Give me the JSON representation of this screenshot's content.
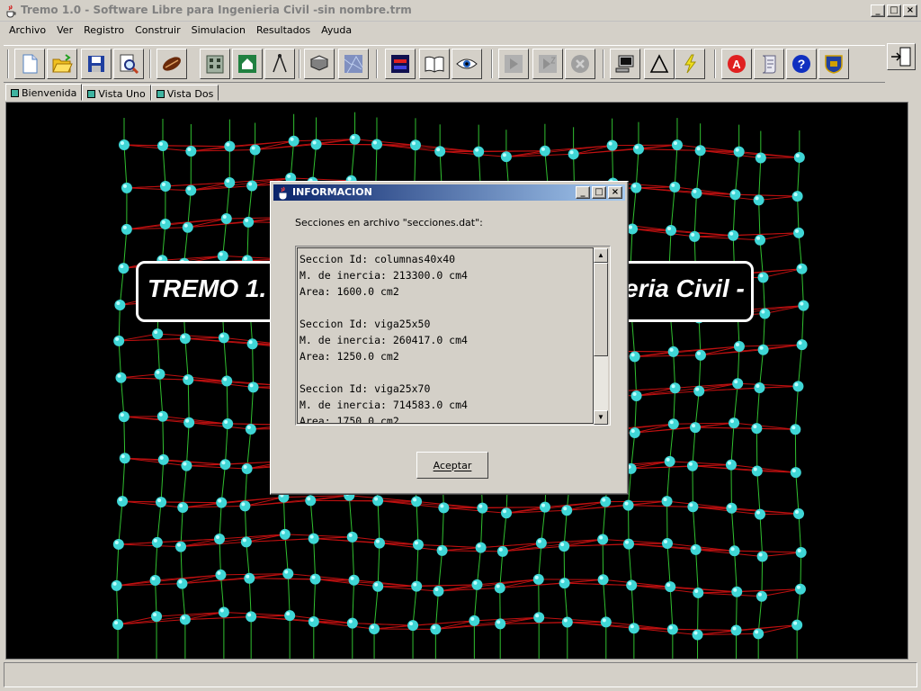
{
  "window": {
    "title": "Tremo 1.0 - Software Libre para Ingenieria Civil -sin nombre.trm",
    "controls": [
      "_",
      "□",
      "×"
    ]
  },
  "menu": [
    "Archivo",
    "Ver",
    "Registro",
    "Construir",
    "Simulacion",
    "Resultados",
    "Ayuda"
  ],
  "toolbar": {
    "groups": [
      [
        "new-file-icon",
        "open-folder-icon",
        "save-icon",
        "print-preview-icon"
      ],
      [
        "beam-icon",
        "building-icon",
        "house-icon",
        "compass-icon"
      ],
      [
        "section-icon",
        "material-icon"
      ],
      [
        "load-icon",
        "book-icon",
        "eye-icon"
      ],
      [
        "play-icon",
        "step-icon",
        "stop-icon"
      ],
      [
        "monitor-icon",
        "delta-icon",
        "lightning-icon"
      ],
      [
        "help-a-icon",
        "script-icon",
        "question-icon",
        "crest-icon"
      ]
    ],
    "disabled": [
      "play-icon",
      "step-icon",
      "stop-icon"
    ]
  },
  "tabs": [
    {
      "label": "Bienvenida",
      "active": true
    },
    {
      "label": "Vista Uno",
      "active": false
    },
    {
      "label": "Vista Dos",
      "active": false
    }
  ],
  "canvas": {
    "banner_left": "TREMO 1.",
    "banner_right": "eria Civil -",
    "colors": {
      "background": "#000000",
      "node": "#3fd6d6",
      "beam": "#c01010",
      "column": "#30c030"
    }
  },
  "dialog": {
    "title": "INFORMACION",
    "message": "Secciones en archivo \"secciones.dat\":",
    "lines": [
      "Seccion Id: columnas40x40",
      "M. de inercia: 213300.0 cm4",
      "Area: 1600.0 cm2",
      "",
      "Seccion Id: viga25x50",
      "M. de inercia: 260417.0 cm4",
      "Area: 1250.0 cm2",
      "",
      "Seccion Id: viga25x70",
      "M. de inercia: 714583.0 cm4",
      "Area: 1750.0 cm2"
    ],
    "ok_label": "Aceptar"
  }
}
